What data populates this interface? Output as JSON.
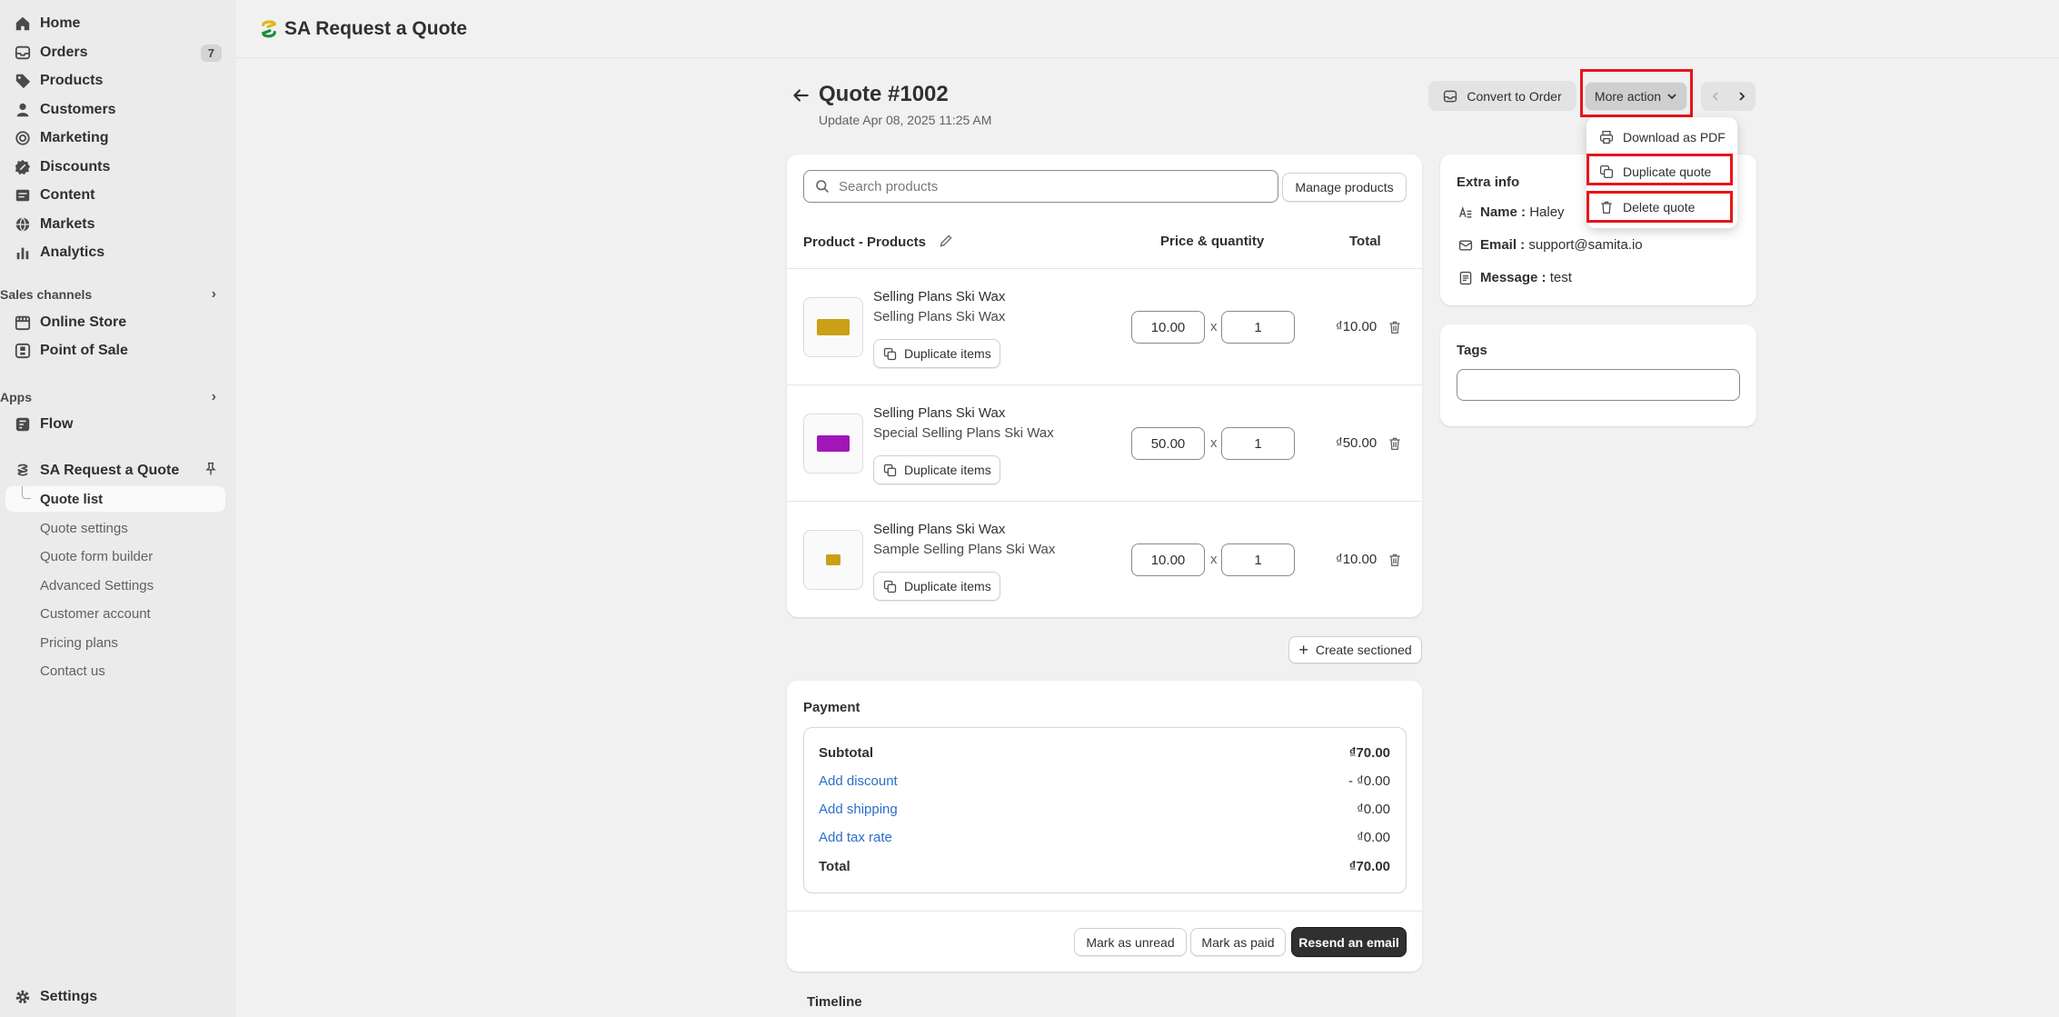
{
  "sidebar": {
    "nav": [
      {
        "label": "Home",
        "icon": "home-icon"
      },
      {
        "label": "Orders",
        "icon": "orders-icon",
        "badge": "7"
      },
      {
        "label": "Products",
        "icon": "tag-icon"
      },
      {
        "label": "Customers",
        "icon": "person-icon"
      },
      {
        "label": "Marketing",
        "icon": "target-icon"
      },
      {
        "label": "Discounts",
        "icon": "discount-icon"
      },
      {
        "label": "Content",
        "icon": "content-icon"
      },
      {
        "label": "Markets",
        "icon": "globe-icon"
      },
      {
        "label": "Analytics",
        "icon": "chart-icon"
      }
    ],
    "sales_channels_title": "Sales channels",
    "sales_channels": [
      {
        "label": "Online Store",
        "icon": "store-icon"
      },
      {
        "label": "Point of Sale",
        "icon": "pos-icon"
      }
    ],
    "apps_title": "Apps",
    "apps": [
      {
        "label": "Flow",
        "icon": "flow-icon"
      },
      {
        "label": "SA Request a Quote",
        "icon": "app-icon"
      }
    ],
    "app_sub": [
      "Quote list",
      "Quote settings",
      "Quote form builder",
      "Advanced Settings",
      "Customer account",
      "Pricing plans",
      "Contact us"
    ],
    "settings_label": "Settings"
  },
  "topbar": {
    "title": "SA Request a Quote"
  },
  "header": {
    "title": "Quote #1002",
    "subtitle": "Update Apr 08, 2025 11:25 AM",
    "convert_label": "Convert to Order",
    "more_action_label": "More action"
  },
  "dropdown": {
    "items": [
      "Download as PDF",
      "Duplicate quote",
      "Delete quote"
    ]
  },
  "products": {
    "search_placeholder": "Search products",
    "manage_label": "Manage products",
    "col_product": "Product - Products",
    "col_price": "Price & quantity",
    "col_total": "Total",
    "dup_label": "Duplicate items",
    "times": "x",
    "rows": [
      {
        "name": "Selling Plans Ski Wax",
        "variant": "Selling Plans Ski Wax",
        "price": "10.00",
        "qty": "1",
        "total": "₫10.00",
        "color": "#c9a016"
      },
      {
        "name": "Selling Plans Ski Wax",
        "variant": "Special Selling Plans Ski Wax",
        "price": "50.00",
        "qty": "1",
        "total": "₫50.00",
        "color": "#a016b8"
      },
      {
        "name": "Selling Plans Ski Wax",
        "variant": "Sample Selling Plans Ski Wax",
        "price": "10.00",
        "qty": "1",
        "total": "₫10.00",
        "color": "#c9a016"
      }
    ]
  },
  "create_section_label": "Create sectioned",
  "payment": {
    "title": "Payment",
    "subtotal_label": "Subtotal",
    "subtotal": "₫70.00",
    "discount_label": "Add discount",
    "discount": "- ₫0.00",
    "shipping_label": "Add shipping",
    "shipping": "₫0.00",
    "tax_label": "Add tax rate",
    "tax": "₫0.00",
    "total_label": "Total",
    "total": "₫70.00",
    "mark_unread": "Mark as unread",
    "mark_paid": "Mark as paid",
    "resend": "Resend an email"
  },
  "timeline_title": "Timeline",
  "extra_info": {
    "title": "Extra info",
    "name_label": "Name :",
    "name": "Haley",
    "email_label": "Email :",
    "email": "support@samita.io",
    "message_label": "Message :",
    "message": "test"
  },
  "tags": {
    "title": "Tags",
    "value": ""
  }
}
